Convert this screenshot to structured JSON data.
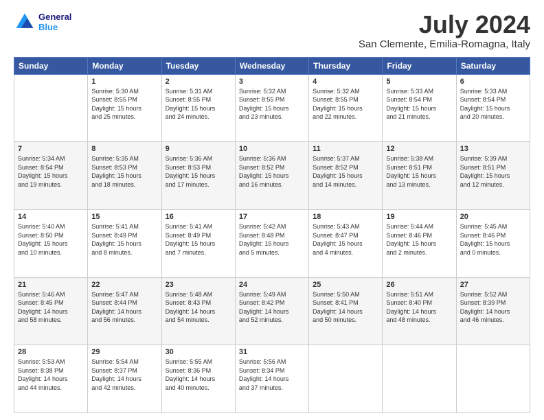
{
  "logo": {
    "line1": "General",
    "line2": "Blue"
  },
  "title": "July 2024",
  "location": "San Clemente, Emilia-Romagna, Italy",
  "weekdays": [
    "Sunday",
    "Monday",
    "Tuesday",
    "Wednesday",
    "Thursday",
    "Friday",
    "Saturday"
  ],
  "weeks": [
    [
      {
        "day": "",
        "info": ""
      },
      {
        "day": "1",
        "info": "Sunrise: 5:30 AM\nSunset: 8:55 PM\nDaylight: 15 hours\nand 25 minutes."
      },
      {
        "day": "2",
        "info": "Sunrise: 5:31 AM\nSunset: 8:55 PM\nDaylight: 15 hours\nand 24 minutes."
      },
      {
        "day": "3",
        "info": "Sunrise: 5:32 AM\nSunset: 8:55 PM\nDaylight: 15 hours\nand 23 minutes."
      },
      {
        "day": "4",
        "info": "Sunrise: 5:32 AM\nSunset: 8:55 PM\nDaylight: 15 hours\nand 22 minutes."
      },
      {
        "day": "5",
        "info": "Sunrise: 5:33 AM\nSunset: 8:54 PM\nDaylight: 15 hours\nand 21 minutes."
      },
      {
        "day": "6",
        "info": "Sunrise: 5:33 AM\nSunset: 8:54 PM\nDaylight: 15 hours\nand 20 minutes."
      }
    ],
    [
      {
        "day": "7",
        "info": "Sunrise: 5:34 AM\nSunset: 8:54 PM\nDaylight: 15 hours\nand 19 minutes."
      },
      {
        "day": "8",
        "info": "Sunrise: 5:35 AM\nSunset: 8:53 PM\nDaylight: 15 hours\nand 18 minutes."
      },
      {
        "day": "9",
        "info": "Sunrise: 5:36 AM\nSunset: 8:53 PM\nDaylight: 15 hours\nand 17 minutes."
      },
      {
        "day": "10",
        "info": "Sunrise: 5:36 AM\nSunset: 8:52 PM\nDaylight: 15 hours\nand 16 minutes."
      },
      {
        "day": "11",
        "info": "Sunrise: 5:37 AM\nSunset: 8:52 PM\nDaylight: 15 hours\nand 14 minutes."
      },
      {
        "day": "12",
        "info": "Sunrise: 5:38 AM\nSunset: 8:51 PM\nDaylight: 15 hours\nand 13 minutes."
      },
      {
        "day": "13",
        "info": "Sunrise: 5:39 AM\nSunset: 8:51 PM\nDaylight: 15 hours\nand 12 minutes."
      }
    ],
    [
      {
        "day": "14",
        "info": "Sunrise: 5:40 AM\nSunset: 8:50 PM\nDaylight: 15 hours\nand 10 minutes."
      },
      {
        "day": "15",
        "info": "Sunrise: 5:41 AM\nSunset: 8:49 PM\nDaylight: 15 hours\nand 8 minutes."
      },
      {
        "day": "16",
        "info": "Sunrise: 5:41 AM\nSunset: 8:49 PM\nDaylight: 15 hours\nand 7 minutes."
      },
      {
        "day": "17",
        "info": "Sunrise: 5:42 AM\nSunset: 8:48 PM\nDaylight: 15 hours\nand 5 minutes."
      },
      {
        "day": "18",
        "info": "Sunrise: 5:43 AM\nSunset: 8:47 PM\nDaylight: 15 hours\nand 4 minutes."
      },
      {
        "day": "19",
        "info": "Sunrise: 5:44 AM\nSunset: 8:46 PM\nDaylight: 15 hours\nand 2 minutes."
      },
      {
        "day": "20",
        "info": "Sunrise: 5:45 AM\nSunset: 8:46 PM\nDaylight: 15 hours\nand 0 minutes."
      }
    ],
    [
      {
        "day": "21",
        "info": "Sunrise: 5:46 AM\nSunset: 8:45 PM\nDaylight: 14 hours\nand 58 minutes."
      },
      {
        "day": "22",
        "info": "Sunrise: 5:47 AM\nSunset: 8:44 PM\nDaylight: 14 hours\nand 56 minutes."
      },
      {
        "day": "23",
        "info": "Sunrise: 5:48 AM\nSunset: 8:43 PM\nDaylight: 14 hours\nand 54 minutes."
      },
      {
        "day": "24",
        "info": "Sunrise: 5:49 AM\nSunset: 8:42 PM\nDaylight: 14 hours\nand 52 minutes."
      },
      {
        "day": "25",
        "info": "Sunrise: 5:50 AM\nSunset: 8:41 PM\nDaylight: 14 hours\nand 50 minutes."
      },
      {
        "day": "26",
        "info": "Sunrise: 5:51 AM\nSunset: 8:40 PM\nDaylight: 14 hours\nand 48 minutes."
      },
      {
        "day": "27",
        "info": "Sunrise: 5:52 AM\nSunset: 8:39 PM\nDaylight: 14 hours\nand 46 minutes."
      }
    ],
    [
      {
        "day": "28",
        "info": "Sunrise: 5:53 AM\nSunset: 8:38 PM\nDaylight: 14 hours\nand 44 minutes."
      },
      {
        "day": "29",
        "info": "Sunrise: 5:54 AM\nSunset: 8:37 PM\nDaylight: 14 hours\nand 42 minutes."
      },
      {
        "day": "30",
        "info": "Sunrise: 5:55 AM\nSunset: 8:36 PM\nDaylight: 14 hours\nand 40 minutes."
      },
      {
        "day": "31",
        "info": "Sunrise: 5:56 AM\nSunset: 8:34 PM\nDaylight: 14 hours\nand 37 minutes."
      },
      {
        "day": "",
        "info": ""
      },
      {
        "day": "",
        "info": ""
      },
      {
        "day": "",
        "info": ""
      }
    ]
  ]
}
